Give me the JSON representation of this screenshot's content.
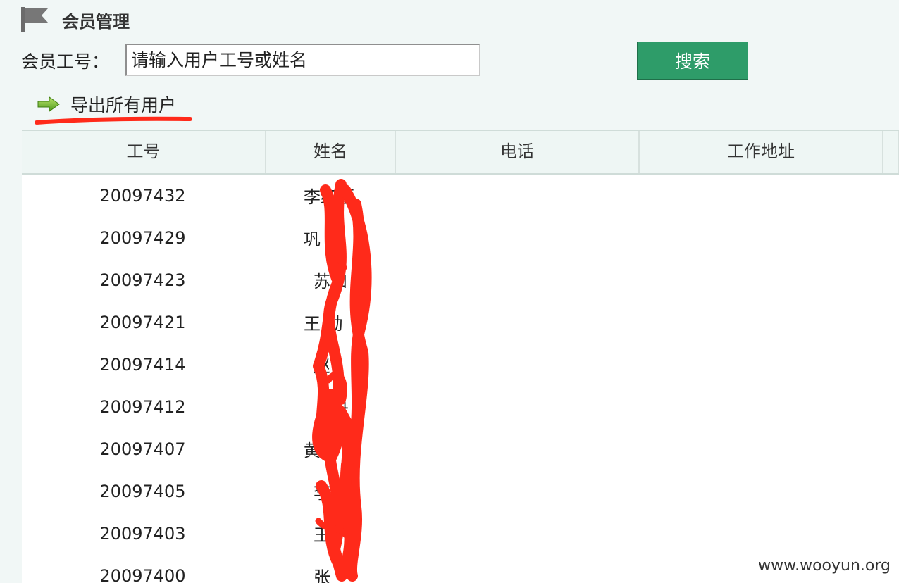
{
  "header": {
    "title": "会员管理",
    "flag_icon": "flag-icon"
  },
  "search": {
    "label": "会员工号：",
    "placeholder": "请输入用户工号或姓名",
    "value": "",
    "button_label": "搜索"
  },
  "export": {
    "icon": "arrow-right-icon",
    "label": "导出所有用户"
  },
  "table": {
    "columns": [
      "工号",
      "姓名",
      "电话",
      "工作地址",
      ""
    ],
    "rows": [
      {
        "id": "20097432",
        "name": "李红蕾"
      },
      {
        "id": "20097429",
        "name": "巩"
      },
      {
        "id": "20097423",
        "name": "苏和"
      },
      {
        "id": "20097421",
        "name": "王   勋"
      },
      {
        "id": "20097414",
        "name": "赵"
      },
      {
        "id": "20097412",
        "name": "丹"
      },
      {
        "id": "20097407",
        "name": "黄彩"
      },
      {
        "id": "20097405",
        "name": "李"
      },
      {
        "id": "20097403",
        "name": "王"
      },
      {
        "id": "20097400",
        "name": "张"
      }
    ]
  },
  "watermark": "www.wooyun.org",
  "colors": {
    "button_bg": "#2e9c69",
    "redaction": "#ff2a1a",
    "page_bg": "#f1f7f6"
  }
}
